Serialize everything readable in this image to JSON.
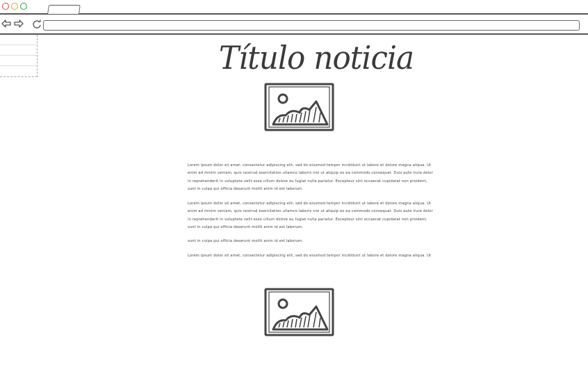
{
  "page": {
    "title": "Título noticia"
  },
  "paragraphs": [
    "Lorem ipsum dolor sit amet, consectetur adipiscing elit, sed do eiusmod tempor incididunt ut labore et dolore magna aliqua. Ut enim ad minim veniam, quis nostrud exercitation ullamco laboris nisi ut aliquip ex ea commodo consequat. Duis aute irure dolor in reprehenderit in voluptate velit esse cillum dolore eu fugiat nulla pariatur. Excepteur sint occaecat cupidatat non proident, sunt in culpa qui officia deserunt mollit anim id est laborum.",
    "Lorem ipsum dolor sit amet, consectetur adipiscing elit, sed do eiusmod tempor incididunt ut labore et dolore magna aliqua. Ut enim ad minim veniam, quis nostrud exercitation ullamco laboris nisi ut aliquip ex ea commodo consequat. Duis aute irure dolor in reprehenderit in voluptate velit esse cillum dolore eu fugiat nulla pariatur. Excepteur sint occaecat cupidatat non proident, sunt in culpa qui officia deserunt mollit anim id est laborum.",
    "sunt in culpa qui officia deserunt mollit anim id est laborum.",
    "Lorem ipsum dolor sit amet, consectetur adipiscing elit, sed do eiusmod tempor incididunt ut labore et dolore magna aliqua. Ut"
  ],
  "icons": {
    "back": "back-arrow-icon",
    "forward": "forward-arrow-icon",
    "reload": "reload-icon",
    "image": "image-placeholder-icon"
  },
  "colors": {
    "close_dot": "#e0443e",
    "minimize_dot": "#dea123",
    "maximize_dot": "#1aab29",
    "sketch_stroke": "#444444"
  }
}
